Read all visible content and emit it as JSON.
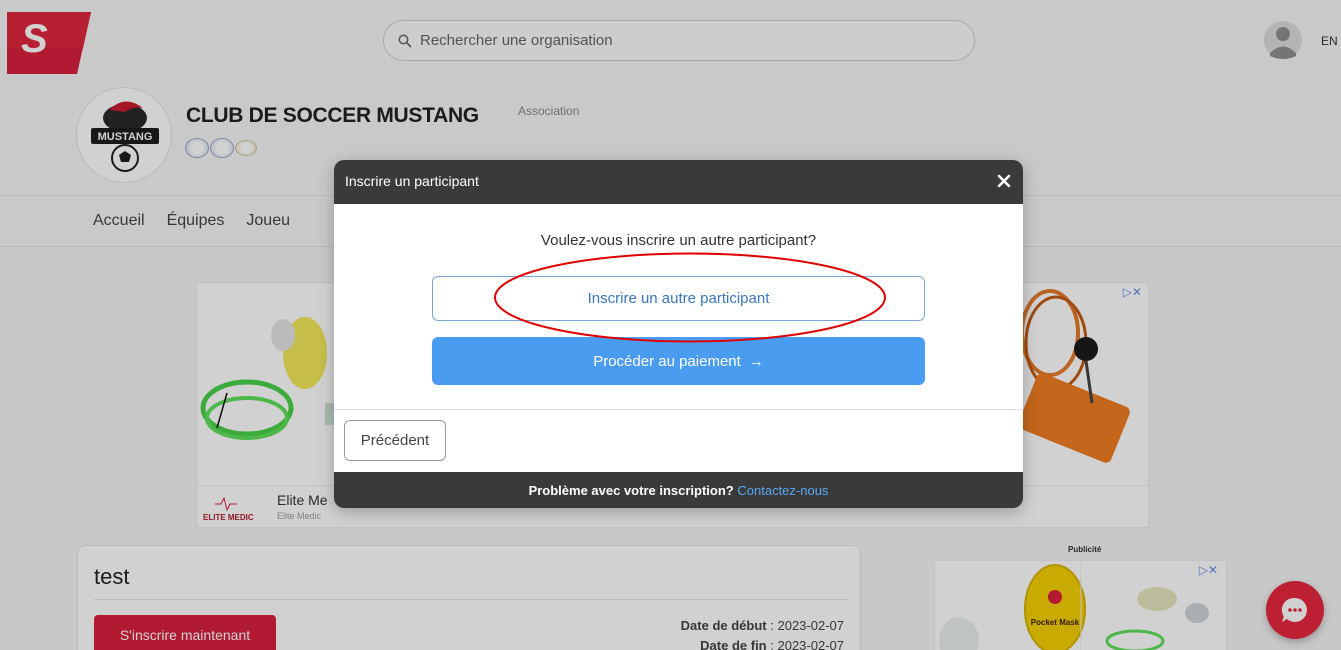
{
  "topbar": {
    "search_placeholder": "Rechercher une organisation",
    "language": "EN"
  },
  "club": {
    "name": "CLUB DE SOCCER MUSTANG",
    "type": "Association",
    "logo_text": "MUSTANG"
  },
  "nav": {
    "items": [
      "Accueil",
      "Équipes",
      "Joueu"
    ]
  },
  "ad_main": {
    "advertiser": "Elite Me",
    "advertiser_sub": "Elite Medic",
    "logo_text": "ELITE MEDIC"
  },
  "event": {
    "title": "test",
    "register_label": "S'inscrire maintenant",
    "start_label": "Date de début",
    "start_value": ": 2023-02-07",
    "end_label": "Date de fin",
    "end_value": ": 2023-02-07"
  },
  "side_ad": {
    "label": "Publicité",
    "product_text": "Pocket Mask"
  },
  "modal": {
    "title": "Inscrire un participant",
    "question": "Voulez-vous inscrire un autre participant?",
    "another_label": "Inscrire un autre participant",
    "pay_label": "Procéder au paiement",
    "pay_arrow": "→",
    "previous_label": "Précédent",
    "problem_label": "Problème avec votre inscription?",
    "contact_label": "Contactez-nous"
  },
  "colors": {
    "brand_red": "#d8203b",
    "primary_blue": "#4a9cf0",
    "modal_dark": "#3a3a3a",
    "annotation_red": "#e00000"
  },
  "icons": {
    "search": "search-icon",
    "close": "close-icon",
    "user": "user-icon",
    "chat": "chat-icon",
    "adchoices": "adchoices-icon"
  }
}
